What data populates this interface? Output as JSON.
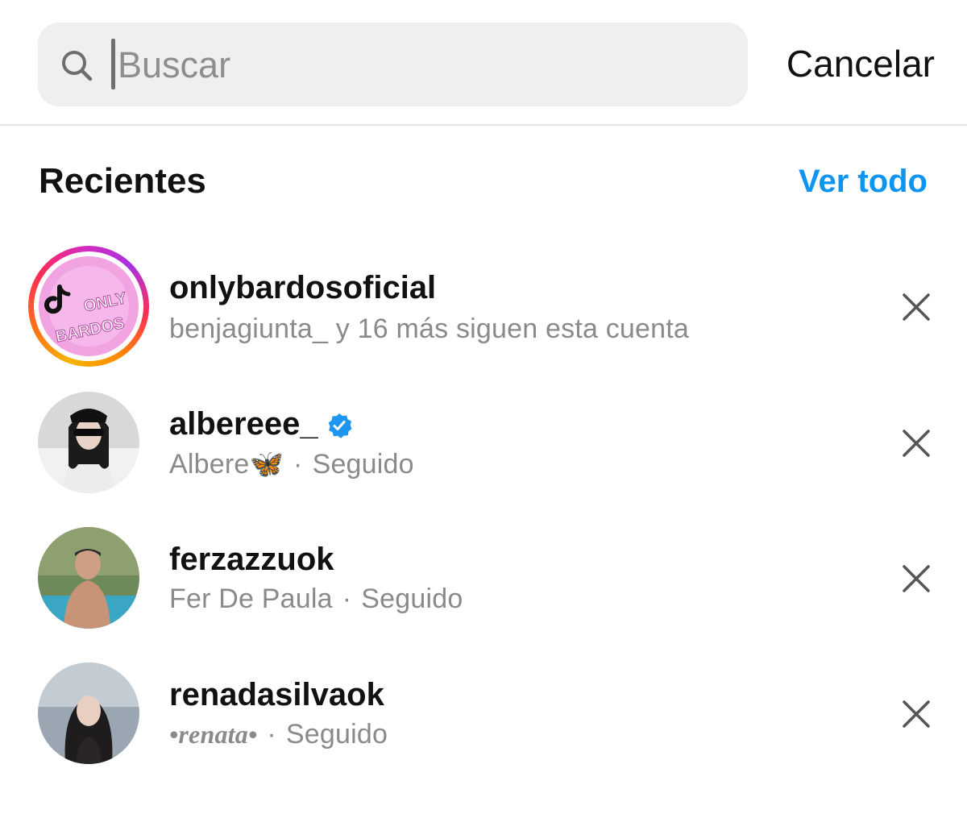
{
  "search": {
    "placeholder": "Buscar",
    "value": "",
    "cancel_label": "Cancelar"
  },
  "recents": {
    "title": "Recientes",
    "see_all_label": "Ver todo",
    "items": [
      {
        "username": "onlybardosoficial",
        "subtitle": "benjagiunta_ y 16 más siguen esta cuenta",
        "verified": false,
        "has_story_ring": true,
        "avatar_text_line1": "ONLY",
        "avatar_text_line2": "BARDOS"
      },
      {
        "username": "albereee_",
        "display_name": "Albere",
        "status": "Seguido",
        "verified": true,
        "emoji": "🦋"
      },
      {
        "username": "ferzazzuok",
        "display_name": "Fer De Paula",
        "status": "Seguido",
        "verified": false
      },
      {
        "username": "renadasilvaok",
        "display_name": "•renata•",
        "status": "Seguido",
        "verified": false
      }
    ]
  },
  "colors": {
    "link_blue": "#0d95f0",
    "verified_blue": "#1c96f0",
    "secondary_text": "#8a8a8a",
    "search_bg": "#efefef"
  },
  "icons": {
    "search": "search-icon",
    "remove": "close-icon",
    "verified": "verified-badge-icon"
  }
}
